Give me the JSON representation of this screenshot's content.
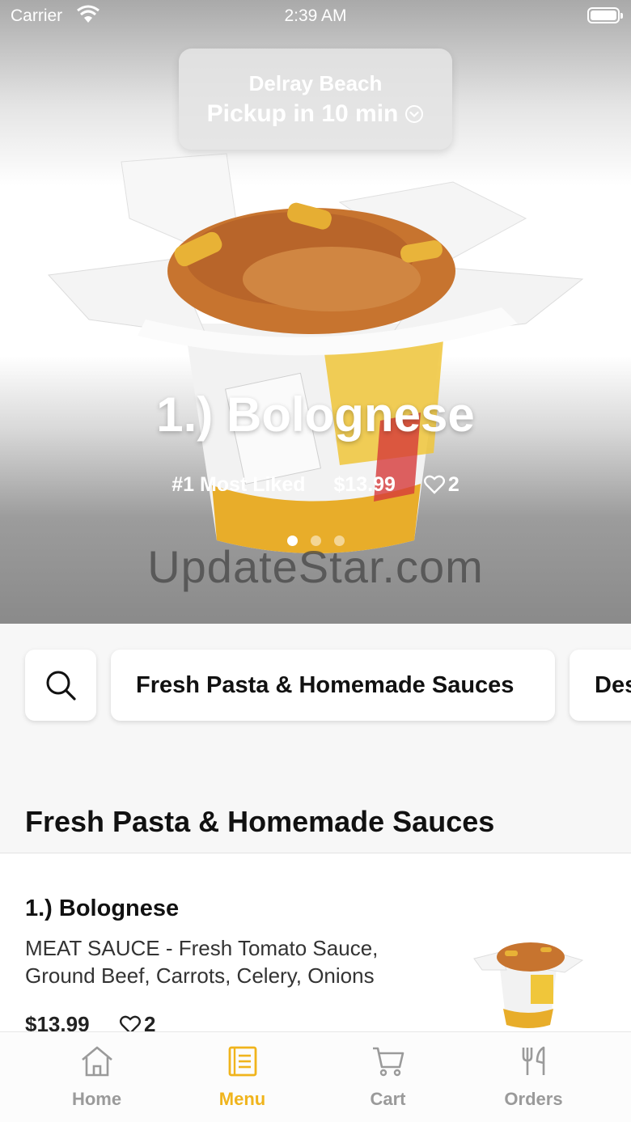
{
  "status_bar": {
    "carrier": "Carrier",
    "time": "2:39 AM"
  },
  "location": {
    "city": "Delray Beach",
    "pickup": "Pickup in 10 min"
  },
  "featured": {
    "title": "1.) Bolog(as shown): \"1.) Bolognese\"",
    "title_text": "1.) Bolognese",
    "badge": "#1 Most Liked",
    "price": "$13.99",
    "likes": "2",
    "active_slide": 1,
    "slide_count": 3
  },
  "watermark": "UpdateStar.com",
  "categories": {
    "search_icon": "search-icon",
    "items": [
      "Fresh Pasta & Homemade Sauces",
      "Des"
    ]
  },
  "section": {
    "title": "Fresh Pasta & Homemade Sauces"
  },
  "menu_items": [
    {
      "name": "1.) Bolognese",
      "description": "MEAT SAUCE - Fresh Tomato Sauce, Ground Beef, Carrots, Celery, Onions",
      "price": "$13.99",
      "likes": "2"
    }
  ],
  "tabs": [
    {
      "label": "Home",
      "icon": "home-icon",
      "active": false
    },
    {
      "label": "Menu",
      "icon": "menu-icon",
      "active": true
    },
    {
      "label": "Cart",
      "icon": "cart-icon",
      "active": false
    },
    {
      "label": "Orders",
      "icon": "orders-icon",
      "active": false
    }
  ],
  "colors": {
    "accent": "#f0b41c",
    "inactive": "#9a9a9a"
  }
}
